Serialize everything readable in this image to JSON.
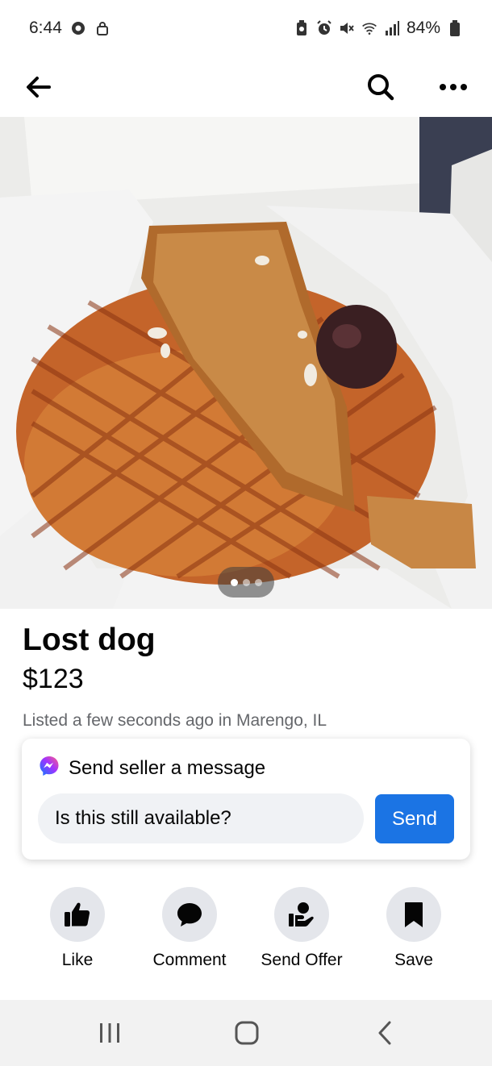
{
  "status_bar": {
    "time": "6:44",
    "battery": "84%"
  },
  "listing": {
    "title": "Lost dog",
    "price": "$123",
    "meta": "Listed a few seconds ago in Marengo, IL",
    "photo_count": 3,
    "active_photo": 1
  },
  "message": {
    "header": "Send seller a message",
    "input_value": "Is this still available?",
    "send_label": "Send"
  },
  "actions": [
    {
      "label": "Like",
      "icon": "thumbs-up-icon"
    },
    {
      "label": "Comment",
      "icon": "comment-icon"
    },
    {
      "label": "Send Offer",
      "icon": "send-offer-icon"
    },
    {
      "label": "Save",
      "icon": "bookmark-icon"
    }
  ],
  "colors": {
    "accent": "#1b74e4",
    "secondary_text": "#65676b",
    "icon_bg": "#e4e6eb"
  }
}
